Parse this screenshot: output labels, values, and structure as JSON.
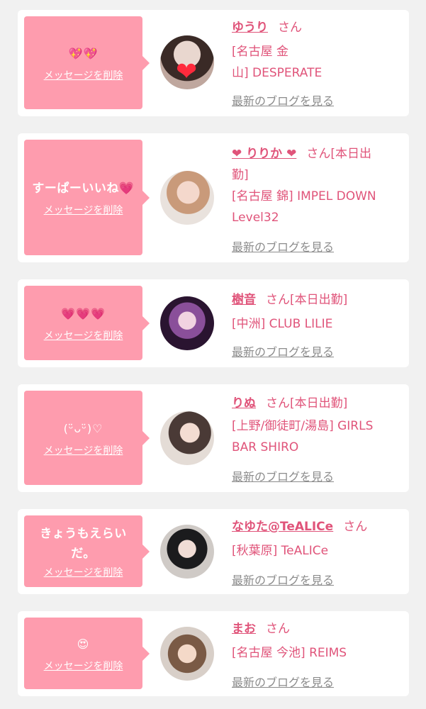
{
  "delete_label": "メッセージを削除",
  "blog_label": "最新のブログを見る",
  "honorific": "さん",
  "accent_color": "#e0547a",
  "bubble_color": "#fe9cae",
  "cards": [
    {
      "message": "💖💖",
      "name": "ゆうり",
      "status": "",
      "shop_line1": "[名古屋 金",
      "shop_line2": "山] DESPERATE"
    },
    {
      "message": "すーぱーいいね💗",
      "name": "❤ りりか ❤",
      "status": "[本日出",
      "status2": "勤]",
      "shop_line1": "[名古屋 錦] IMPEL DOWN",
      "shop_line2": "Level32"
    },
    {
      "message": "💗💗💗",
      "name": "樹音",
      "status": "[本日出勤]",
      "shop_line1": "[中洲] CLUB LILIE"
    },
    {
      "message": "(ᵕ̈ᴗᵕ̈)♡",
      "name": "りぬ",
      "status": "[本日出勤]",
      "shop_line1": "[上野/御徒町/湯島] GIRLS",
      "shop_line2": "BAR SHIRO"
    },
    {
      "message": "きょうもえらい",
      "message2": "だ。",
      "name": "なゆた@TeALICe",
      "status": "",
      "shop_line1": "[秋葉原] TeALICe"
    },
    {
      "message": "😍",
      "name": "まお",
      "status": "",
      "shop_line1": "[名古屋 今池] REIMS"
    }
  ]
}
